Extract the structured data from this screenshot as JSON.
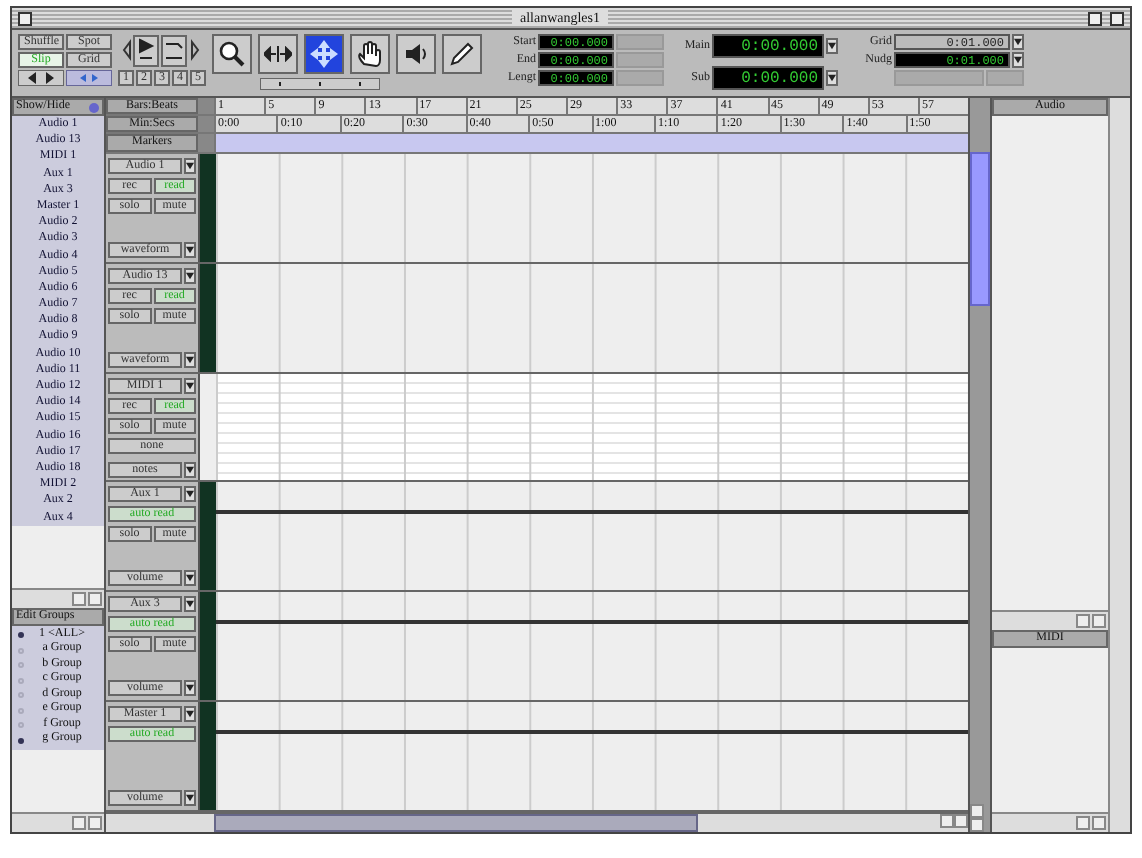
{
  "window": {
    "title": "allanwangles1"
  },
  "edit_modes": [
    {
      "label": "Shuffle",
      "selected": false
    },
    {
      "label": "Spot",
      "selected": false
    },
    {
      "label": "Slip",
      "selected": true
    },
    {
      "label": "Grid",
      "selected": false
    }
  ],
  "zoom_presets": [
    "1",
    "2",
    "3",
    "4",
    "5"
  ],
  "tools": [
    {
      "kind": "zoomer",
      "selected": false
    },
    {
      "kind": "trimmer",
      "selected": false
    },
    {
      "kind": "selector",
      "selected": true
    },
    {
      "kind": "grabber",
      "selected": false
    },
    {
      "kind": "scrubber",
      "selected": false
    },
    {
      "kind": "pencil",
      "selected": false
    }
  ],
  "selection": [
    {
      "label": "Start",
      "value": "0:00.000"
    },
    {
      "label": "End",
      "value": "0:00.000"
    },
    {
      "label": "Lengt",
      "value": "0:00.000"
    }
  ],
  "counters": [
    {
      "label": "Main",
      "value": "0:00.000"
    },
    {
      "label": "Sub",
      "value": "0:00.000"
    }
  ],
  "grid": {
    "label": "Grid",
    "value": "0:01.000"
  },
  "nudge": {
    "label": "Nudg",
    "value": "0:01.000"
  },
  "show_hide": {
    "title": "Show/Hide",
    "tracks": [
      "Audio 1",
      "Audio 13",
      "MIDI 1",
      "Aux 1",
      "Aux 3",
      "Master 1",
      "Audio 2",
      "Audio 3",
      "Audio 4",
      "Audio 5",
      "Audio 6",
      "Audio 7",
      "Audio 8",
      "Audio 9",
      "Audio 10",
      "Audio 11",
      "Audio 12",
      "Audio 14",
      "Audio 15",
      "Audio 16",
      "Audio 17",
      "Audio 18",
      "MIDI 2",
      "Aux 2",
      "Aux 4"
    ]
  },
  "edit_groups": {
    "title": "Edit Groups",
    "items": [
      {
        "label": "1 <ALL>",
        "active": true
      },
      {
        "label": "a Group",
        "active": false
      },
      {
        "label": "b Group",
        "active": false
      },
      {
        "label": "c Group",
        "active": false
      },
      {
        "label": "d Group",
        "active": false
      },
      {
        "label": "e Group",
        "active": false
      },
      {
        "label": "f Group",
        "active": false
      },
      {
        "label": "g Group",
        "active": true
      }
    ]
  },
  "rulers": [
    {
      "label": "Bars:Beats",
      "ticks": [
        "1",
        "5",
        "9",
        "13",
        "17",
        "21",
        "25",
        "29",
        "33",
        "37",
        "41",
        "45",
        "49",
        "53",
        "57"
      ]
    },
    {
      "label": "Min:Secs",
      "ticks": [
        "0:00",
        "0:10",
        "0:20",
        "0:30",
        "0:40",
        "0:50",
        "1:00",
        "1:10",
        "1:20",
        "1:30",
        "1:40",
        "1:50"
      ]
    },
    {
      "label": "Markers"
    }
  ],
  "tracks": [
    {
      "name": "Audio 1",
      "kind": "audio",
      "rows": [
        [
          {
            "label": "rec",
            "kind": "toggle"
          },
          {
            "label": "read",
            "kind": "automation"
          }
        ],
        [
          {
            "label": "solo",
            "kind": "toggle"
          },
          {
            "label": "mute",
            "kind": "toggle"
          }
        ]
      ],
      "view": "waveform"
    },
    {
      "name": "Audio 13",
      "kind": "audio",
      "rows": [
        [
          {
            "label": "rec",
            "kind": "toggle"
          },
          {
            "label": "read",
            "kind": "automation"
          }
        ],
        [
          {
            "label": "solo",
            "kind": "toggle"
          },
          {
            "label": "mute",
            "kind": "toggle"
          }
        ]
      ],
      "view": "waveform"
    },
    {
      "name": "MIDI 1",
      "kind": "midi",
      "rows": [
        [
          {
            "label": "rec",
            "kind": "toggle"
          },
          {
            "label": "read",
            "kind": "automation"
          }
        ],
        [
          {
            "label": "solo",
            "kind": "toggle"
          },
          {
            "label": "mute",
            "kind": "toggle"
          }
        ],
        [
          {
            "label": "none",
            "kind": "toggle"
          }
        ]
      ],
      "view": "notes"
    },
    {
      "name": "Aux 1",
      "kind": "aux",
      "rows": [
        [
          {
            "label": "auto read",
            "kind": "automation"
          }
        ],
        [
          {
            "label": "solo",
            "kind": "toggle"
          },
          {
            "label": "mute",
            "kind": "toggle"
          }
        ]
      ],
      "view": "volume"
    },
    {
      "name": "Aux 3",
      "kind": "aux",
      "rows": [
        [
          {
            "label": "auto read",
            "kind": "automation"
          }
        ],
        [
          {
            "label": "solo",
            "kind": "toggle"
          },
          {
            "label": "mute",
            "kind": "toggle"
          }
        ]
      ],
      "view": "volume"
    },
    {
      "name": "Master 1",
      "kind": "master",
      "rows": [
        [
          {
            "label": "auto read",
            "kind": "automation"
          }
        ]
      ],
      "view": "volume"
    }
  ],
  "regions": [
    {
      "title": "Audio"
    },
    {
      "title": "MIDI"
    }
  ]
}
